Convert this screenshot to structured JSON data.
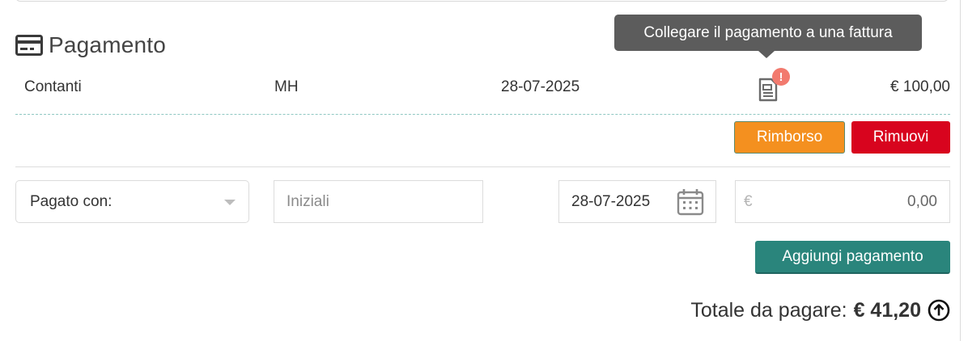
{
  "section": {
    "title": "Pagamento",
    "icon": "credit-card-icon"
  },
  "tooltip": {
    "text": "Collegare il pagamento a una fattura"
  },
  "payment": {
    "method": "Contanti",
    "initials": "MH",
    "date": "28-07-2025",
    "amount": "€ 100,00",
    "invoice_icon": "document-icon",
    "alert_badge": "!"
  },
  "actions": {
    "refund_label": "Rimborso",
    "remove_label": "Rimuovi"
  },
  "form": {
    "paid_with_label": "Pagato con:",
    "initials_placeholder": "Iniziali",
    "date_value": "28-07-2025",
    "currency_symbol": "€",
    "amount_value": "0,00",
    "add_payment_label": "Aggiungi pagamento"
  },
  "summary": {
    "total_label": "Totale da pagare:",
    "total_value": "€ 41,20",
    "icon": "arrow-up-circle-icon"
  },
  "colors": {
    "refund": "#f4901f",
    "remove": "#d8041e",
    "add_payment": "#2a857c",
    "tooltip_bg": "#5c5c5c",
    "alert_badge": "#f27a6e"
  }
}
